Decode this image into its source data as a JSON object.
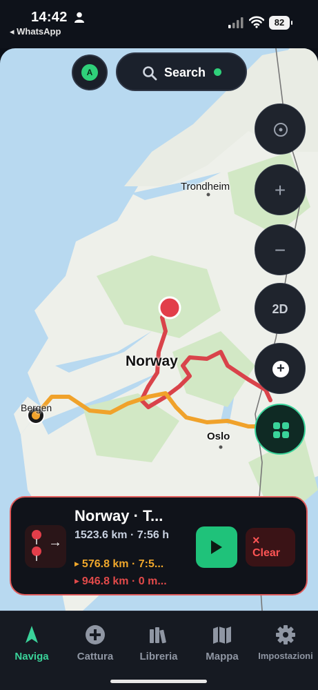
{
  "status_bar": {
    "time": "14:42",
    "back_app": "WhatsApp",
    "battery": "82",
    "icons": [
      "person-icon",
      "signal-icon",
      "wifi-icon",
      "battery-icon"
    ]
  },
  "map": {
    "labels": {
      "trondheim": "Trondheim",
      "norway": "Norway",
      "oslo": "Oslo",
      "bergen": "Bergen"
    },
    "colors": {
      "water": "#b8d9f0",
      "land": "#eef0ea",
      "forest": "#cfe6c2",
      "route_red": "#d9434a",
      "route_orange": "#f0a22b"
    }
  },
  "top_bar": {
    "avatar_letter": "A",
    "search_label": "Search",
    "search_status_color": "#2fd07a"
  },
  "map_controls": {
    "locate_icon": "target-icon",
    "zoom_in": "+",
    "zoom_out": "−",
    "view_mode": "2D",
    "add_icon": "add-icon",
    "layers_icon": "grid-icon"
  },
  "route_card": {
    "title": "Norway · T...",
    "total": "1523.6 km · 7:56 h",
    "orange_segment": "576.8 km · 7:5...",
    "red_segment": "946.8 km · 0 m...",
    "play_icon": "play-icon",
    "clear_icon": "×",
    "clear_label": "Clear",
    "accent_color": "#e05b5b"
  },
  "tabs": [
    {
      "label": "Naviga",
      "icon": "navigation-arrow-icon",
      "active": true
    },
    {
      "label": "Cattura",
      "icon": "plus-circle-icon",
      "active": false
    },
    {
      "label": "Libreria",
      "icon": "library-icon",
      "active": false
    },
    {
      "label": "Mappa",
      "icon": "map-icon",
      "active": false
    },
    {
      "label": "Impostazioni",
      "icon": "settings-gear-icon",
      "active": false
    }
  ]
}
